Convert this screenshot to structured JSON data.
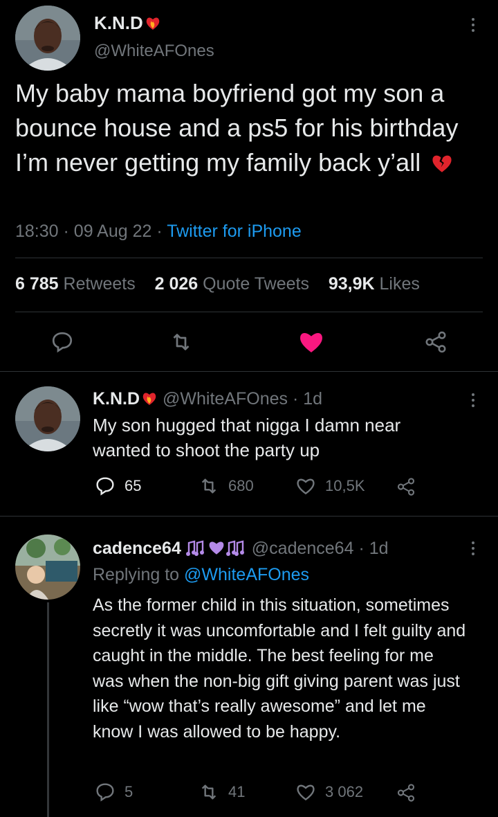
{
  "main_tweet": {
    "display_name": "K.N.D",
    "name_emoji": "fire-heart-emoji",
    "handle": "@WhiteAFOnes",
    "text": "My baby mama boyfriend got my son a bounce house and a ps5 for his birthday I’m never getting my family back y’all",
    "text_emoji": "broken-heart-emoji",
    "time": "18:30",
    "date": "09 Aug 22",
    "source": "Twitter for iPhone",
    "retweets_count": "6 785",
    "retweets_label": "Retweets",
    "quotes_count": "2 026",
    "quotes_label": "Quote Tweets",
    "likes_count": "93,9K",
    "likes_label": "Likes",
    "liked_color": "#f91880"
  },
  "reply1": {
    "display_name": "K.N.D",
    "handle": "@WhiteAFOnes",
    "age": "1d",
    "text": "My son hugged that nigga I damn near wanted to shoot the party up",
    "replies": "65",
    "retweets": "680",
    "likes": "10,5K"
  },
  "reply2": {
    "display_name": "cadence64",
    "name_emojis": [
      "music-notes-emoji",
      "purple-heart-emoji",
      "music-notes-emoji"
    ],
    "handle": "@cadence64",
    "age": "1d",
    "replying_label": "Replying to",
    "replying_to": "@WhiteAFOnes",
    "text": "As the former child in this situation, sometimes secretly it was uncomfortable and I felt guilty and caught in the middle. The best feeling for me was when the non-big gift giving parent was just like “wow that’s really awesome” and let me know I was allowed to be happy.",
    "replies": "5",
    "retweets": "41",
    "likes": "3 062"
  },
  "colors": {
    "accent": "#1d9bf0",
    "muted": "#71767b",
    "like": "#f91880",
    "divider": "#2f3336"
  }
}
